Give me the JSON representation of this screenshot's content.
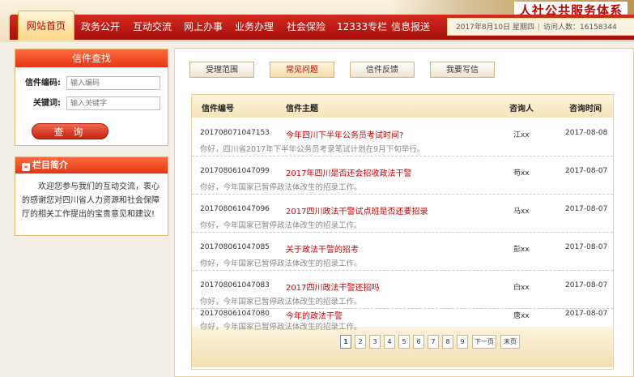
{
  "header": {
    "brand_title": "人社公共服务体系",
    "nav": [
      "网站首页",
      "政务公开",
      "互动交流",
      "网上办事",
      "业务办理",
      "社会保险",
      "12333专栏",
      "信息报送"
    ],
    "date_text": "2017年8月10日 星期四",
    "visitor_label": "访问人数：",
    "visitor_count": "16158344"
  },
  "search": {
    "title": "信件查找",
    "code_label": "信件编码:",
    "code_placeholder": "输入编码",
    "keyword_label": "关键词:",
    "keyword_placeholder": "输入关键字",
    "query_button": "查 询"
  },
  "intro": {
    "title": "栏目简介",
    "text": "欢迎您参与我们的互动交流，衷心的感谢您对四川省人力资源和社会保障厅的相关工作提出的宝贵意见和建议!"
  },
  "tabs": [
    "受理范围",
    "常见问题",
    "信件反馈",
    "我要写信"
  ],
  "active_tab": "常见问题",
  "table": {
    "headers": [
      "信件编号",
      "信件主题",
      "咨询人",
      "咨询时间"
    ],
    "rows": [
      {
        "no": "201708071047153",
        "title": "今年四川下半年公务员考试时间?",
        "name": "江xx",
        "date": "2017-08-08",
        "reply": "你好，四川省2017年下半年公务员考录笔试计划在9月下旬举行。"
      },
      {
        "no": "201708061047099",
        "title": "2017年四川是否还会招收政法干警",
        "name": "苟xx",
        "date": "2017-08-07",
        "reply": "你好，今年国家已暂停政法体改生的招录工作。"
      },
      {
        "no": "201708061047096",
        "title": "2017四川政法干警试点班是否还要招录",
        "name": "马xx",
        "date": "2017-08-07",
        "reply": "你好，今年国家已暂停政法体改生的招录工作。"
      },
      {
        "no": "201708061047085",
        "title": "关于政法干警的招考",
        "name": "彭xx",
        "date": "2017-08-07",
        "reply": "你好，今年国家已暂停政法体改生的招录工作。"
      },
      {
        "no": "201708061047083",
        "title": "2017四川政法干警还招吗",
        "name": "白xx",
        "date": "2017-08-07",
        "reply": "你好，今年国家已暂停政法体改生的招录工作。"
      },
      {
        "no": "201708061047080",
        "title": "今年的政法干警",
        "name": "唐xx",
        "date": "2017-08-07",
        "reply": "你好，今年国家已暂停政法体改生的招录工作。"
      }
    ]
  },
  "pager": {
    "pages": [
      "1",
      "2",
      "3",
      "4",
      "5",
      "6",
      "7",
      "8",
      "9"
    ],
    "current": "1",
    "next_label": "下一页",
    "last_label": "末页"
  },
  "colors": {
    "nav_red": "#c01810",
    "accent_red": "#d40000",
    "panel_border": "#e8d0a4"
  }
}
